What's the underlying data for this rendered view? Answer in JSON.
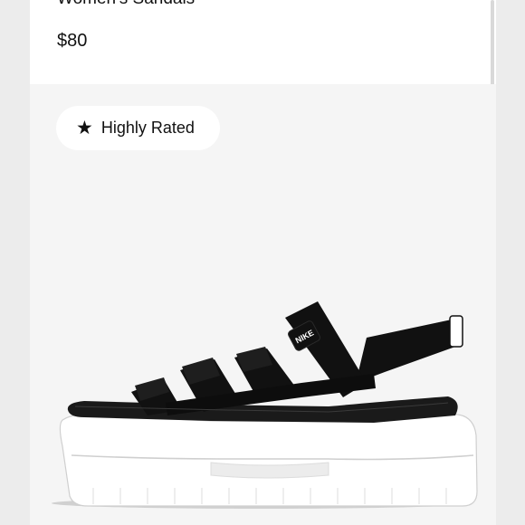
{
  "product": {
    "subtitle": "Women's Sandals",
    "price": "$80"
  },
  "badge": {
    "label": "Highly Rated",
    "icon": "star-icon"
  },
  "image": {
    "logo_text": "NIKE"
  }
}
